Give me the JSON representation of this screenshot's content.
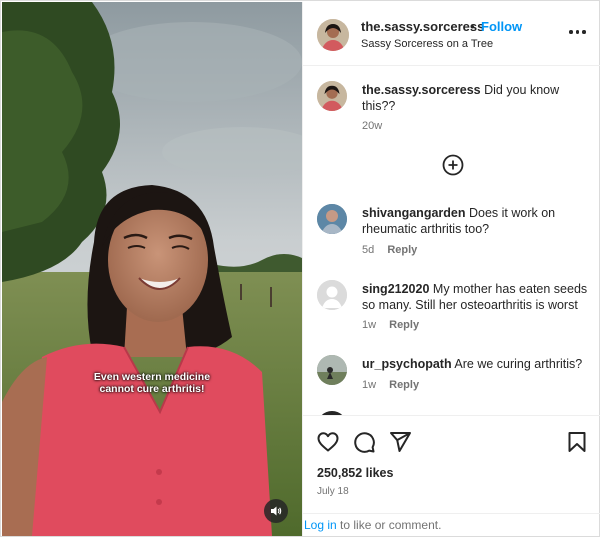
{
  "post": {
    "caption_line1": "Even western medicine",
    "caption_line2": "cannot cure arthritis!"
  },
  "header": {
    "username": "the.sassy.sorceress",
    "dot": "•",
    "follow_label": "Follow",
    "location": "Sassy Sorceress on a Tree"
  },
  "author_comment": {
    "username": "the.sassy.sorceress",
    "text": "Did you know this??",
    "age": "20w"
  },
  "comments": [
    {
      "username": "shivangangarden",
      "text": "Does it work on rheumatic arthritis too?",
      "age": "5d",
      "reply_label": "Reply"
    },
    {
      "username": "sing212020",
      "text": "My mother has eaten seeds so many. Still her osteoarthritis is worst",
      "age": "1w",
      "reply_label": "Reply"
    },
    {
      "username": "ur_psychopath",
      "text": "Are we curing arthritis?",
      "age": "1w",
      "reply_label": "Reply"
    }
  ],
  "stats": {
    "likes": "250,852 likes",
    "date": "July 18"
  },
  "footer": {
    "login_link": "Log in",
    "login_rest": " to like or comment."
  },
  "icons": {
    "more": "more-horizontal-icon",
    "add": "plus-circle-icon",
    "like": "heart-icon",
    "comment": "comment-bubble-icon",
    "share": "paper-plane-icon",
    "save": "bookmark-icon",
    "sound": "speaker-icon"
  },
  "colors": {
    "accent": "#0095f6",
    "text": "#262626",
    "muted": "#737373",
    "shirt": "#e04b5e"
  }
}
